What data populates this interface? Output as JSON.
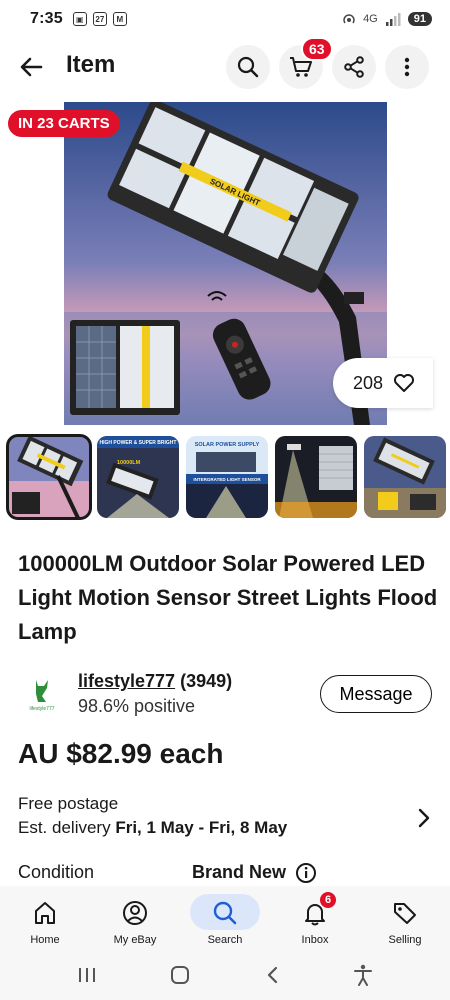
{
  "status": {
    "time": "7:35",
    "net": "4G",
    "battery": "91"
  },
  "header": {
    "title": "Item",
    "cart_count": "63"
  },
  "listing": {
    "carts_tag": "IN 23 CARTS",
    "watch_count": "208",
    "title": "100000LM Outdoor Solar Powered LED Light Motion Sensor Street Lights Flood Lamp",
    "image_text": {
      "main_lamp": "SOLAR LIGHT",
      "thumb2": "HIGH POWER & SUPER BRIGHT",
      "thumb2_b": "10000LM",
      "thumb3": "SOLAR POWER SUPPLY",
      "thumb3_b": "INTERGRATED LIGHT SENSOR"
    }
  },
  "seller": {
    "name": "lifestyle777",
    "feedback": "(3949)",
    "positive": "98.6% positive",
    "message_label": "Message",
    "logo_text": "lifestyle777"
  },
  "price": "AU $82.99 each",
  "shipping": {
    "line1": "Free postage",
    "line2_prefix": "Est. delivery ",
    "line2_dates": "Fri, 1 May - Fri, 8 May"
  },
  "condition": {
    "label": "Condition",
    "value": "Brand New"
  },
  "bottom_nav": [
    {
      "label": "Home"
    },
    {
      "label": "My eBay"
    },
    {
      "label": "Search"
    },
    {
      "label": "Inbox",
      "badge": "6"
    },
    {
      "label": "Selling"
    }
  ],
  "colors": {
    "badge_red": "#e0102a",
    "active_pill": "#dbe6fb"
  }
}
